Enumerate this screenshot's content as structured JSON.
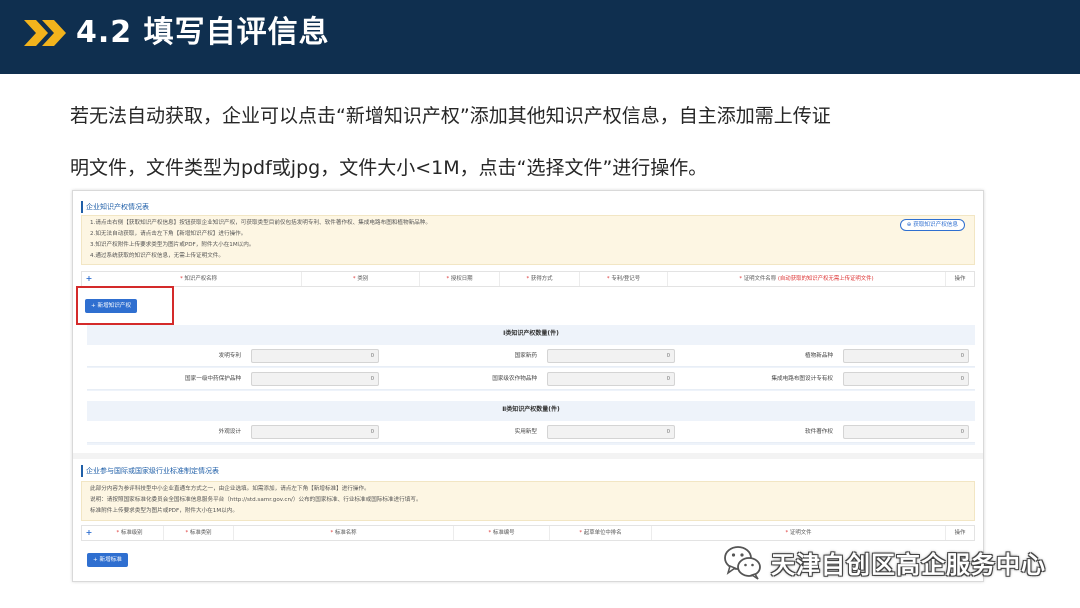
{
  "header": {
    "title": "4.2 填写自评信息",
    "icon": "double-chevron-icon",
    "accent_color": "#f2b31c",
    "background_color": "#0f2f4f"
  },
  "intro": {
    "line1": "若无法自动获取，企业可以点击“新增知识产权”添加其他知识产权信息，自主添加需上传证",
    "line2": "明文件，文件类型为pdf或jpg，文件大小<1M，点击“选择文件”进行操作。"
  },
  "ip_section": {
    "title": "企业知识产权情况表",
    "notes": [
      "1.请点击右侧【获取知识产权信息】按钮获取企业知识产权，可获取类型目前仅包括发明专利、软件著作权、集成电路布图和植物新品种。",
      "2.如无法自动获取，请点击左下角【新增知识产权】进行操作。",
      "3.知识产权附件上传要求类型为图片或PDF，附件大小在1M以内。",
      "4.通过系统获取的知识产权信息，无需上传证明文件。"
    ],
    "fetch_button": "获取知识产权信息",
    "table_headers": {
      "name": "知识产权名称",
      "category": "类别",
      "auth_date": "授权日期",
      "method": "获得方式",
      "patent_no": "专利/登记号",
      "proof_file": "证明文件名称",
      "proof_note": "(自动获取的知识产权无需上传证明文件)",
      "action": "操作"
    },
    "add_button": "新增知识产权",
    "class1": {
      "title": "Ⅰ类知识产权数量(件)",
      "rows": [
        [
          {
            "label": "发明专利",
            "value": "0"
          },
          {
            "label": "国家新药",
            "value": "0"
          },
          {
            "label": "植物新品种",
            "value": "0"
          }
        ],
        [
          {
            "label": "国家一级中药保护品种",
            "value": "0"
          },
          {
            "label": "国家级农作物品种",
            "value": "0"
          },
          {
            "label": "集成电路布图设计专有权",
            "value": "0"
          }
        ]
      ]
    },
    "class2": {
      "title": "Ⅱ类知识产权数量(件)",
      "rows": [
        [
          {
            "label": "外观设计",
            "value": "0"
          },
          {
            "label": "实用新型",
            "value": "0"
          },
          {
            "label": "软件著作权",
            "value": "0"
          }
        ]
      ]
    }
  },
  "std_section": {
    "title": "企业参与国际或国家级行业标准制定情况表",
    "notes": [
      "此部分内容为参评科技型中小企业直通车方式之一，由企业选填。如需添加，请点左下角【新增标准】进行操作。",
      "说明：请按照国家标准化委员会全国标准信息服务平台（http://std.samr.gov.cn/）公布的国家标准、行业标准或国际标准进行填写。",
      "标准附件上传要求类型为图片或PDF，附件大小在1M以内。"
    ],
    "table_headers": {
      "level": "标准级别",
      "category": "标准类别",
      "name": "标准名称",
      "number": "标准编号",
      "drafting_unit": "起草单位中排名",
      "proof_file": "证明文件",
      "action": "操作"
    },
    "add_button": "新增标准"
  },
  "watermark": {
    "text": "天津自创区高企服务中心",
    "icon": "wechat-icon"
  }
}
